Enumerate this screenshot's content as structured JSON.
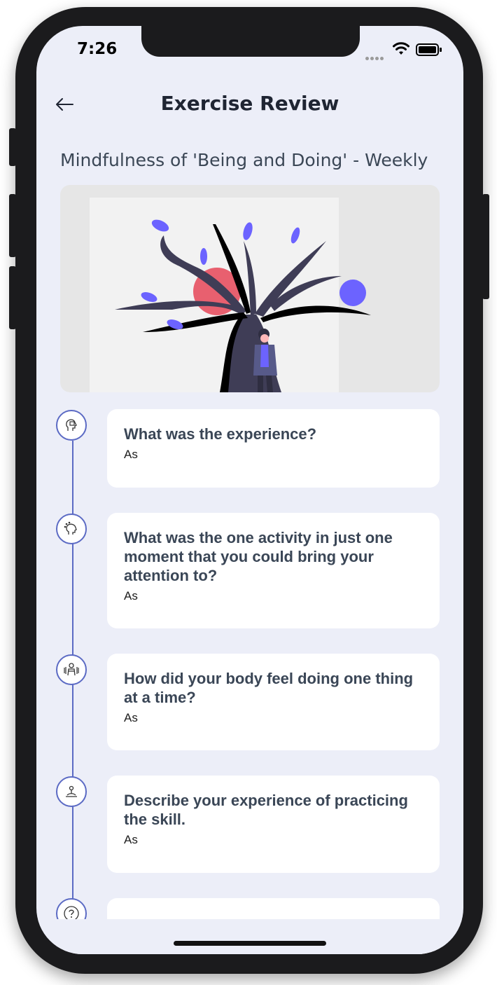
{
  "status_bar": {
    "time": "7:26"
  },
  "header": {
    "title": "Exercise Review"
  },
  "exercise": {
    "name": "Mindfulness of 'Being and Doing' - Weekly"
  },
  "timeline": [
    {
      "icon": "head-calendar-icon",
      "question": "What was the experience?",
      "answer": "As"
    },
    {
      "icon": "head-brain-icon",
      "question": "What was the one activity in just one moment that you could bring your attention to?",
      "answer": "As"
    },
    {
      "icon": "body-meditation-icon",
      "question": "How did your body feel doing one thing at a time?",
      "answer": "As"
    },
    {
      "icon": "meditating-person-icon",
      "question": "Describe your experience of practicing the skill.",
      "answer": "As"
    },
    {
      "icon": "question-icon",
      "question": "",
      "answer": ""
    }
  ],
  "colors": {
    "screen_bg": "#eceef8",
    "accent": "#5b6ac4",
    "text_dark": "#1f2533",
    "leaf": "#6c63ff",
    "sun": "#e8606f"
  }
}
